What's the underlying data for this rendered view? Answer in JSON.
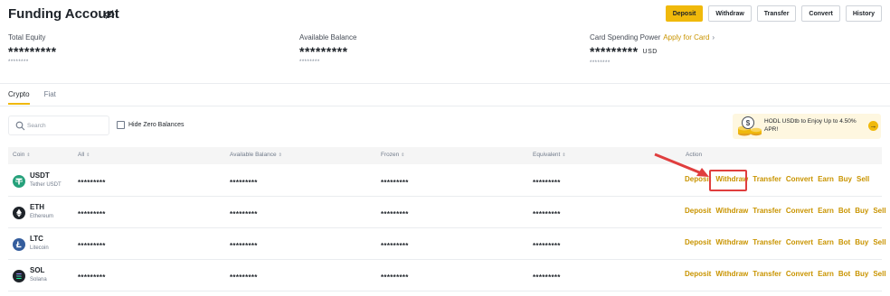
{
  "header": {
    "title": "Funding Account",
    "buttons": [
      "Deposit",
      "Withdraw",
      "Transfer",
      "Convert",
      "History"
    ]
  },
  "summary": {
    "total_equity": {
      "label": "Total Equity",
      "value": "*********",
      "sub": "********"
    },
    "available_balance": {
      "label": "Available Balance",
      "value": "*********",
      "sub": "********"
    },
    "card_power": {
      "label": "Card Spending Power",
      "link": "Apply for Card",
      "value": "*********",
      "unit": "USD",
      "sub": "********"
    }
  },
  "tabs": [
    "Crypto",
    "Fiat"
  ],
  "search": {
    "placeholder": "Search",
    "value": ""
  },
  "hide_zero": {
    "label": "Hide Zero Balances",
    "checked": false
  },
  "promo": {
    "text": "HODL USDtb to Enjoy Up to 4.50% APR!",
    "arrow": "→"
  },
  "table": {
    "headers": {
      "coin": "Coin",
      "all": "All",
      "available": "Available Balance",
      "frozen": "Frozen",
      "equivalent": "Equivalent",
      "action": "Action"
    },
    "rows": [
      {
        "symbol": "USDT",
        "name": "Tether USDT",
        "color": "#26a17b",
        "icon": "tether-icon",
        "all": "*********",
        "available": "*********",
        "frozen": "*********",
        "equivalent": "*********",
        "actions": [
          "Deposit",
          "Withdraw",
          "Transfer",
          "Convert",
          "Earn",
          "Buy",
          "Sell"
        ]
      },
      {
        "symbol": "ETH",
        "name": "Ethereum",
        "color": "#1e2329",
        "icon": "ethereum-icon",
        "all": "*********",
        "available": "*********",
        "frozen": "*********",
        "equivalent": "*********",
        "actions": [
          "Deposit",
          "Withdraw",
          "Transfer",
          "Convert",
          "Earn",
          "Bot",
          "Buy",
          "Sell"
        ]
      },
      {
        "symbol": "LTC",
        "name": "Litecoin",
        "color": "#345d9d",
        "icon": "litecoin-icon",
        "all": "*********",
        "available": "*********",
        "frozen": "*********",
        "equivalent": "*********",
        "actions": [
          "Deposit",
          "Withdraw",
          "Transfer",
          "Convert",
          "Earn",
          "Bot",
          "Buy",
          "Sell"
        ]
      },
      {
        "symbol": "SOL",
        "name": "Solana",
        "color": "#1e2329",
        "icon": "solana-icon",
        "all": "*********",
        "available": "*********",
        "frozen": "*********",
        "equivalent": "*********",
        "actions": [
          "Deposit",
          "Withdraw",
          "Transfer",
          "Convert",
          "Earn",
          "Bot",
          "Buy",
          "Sell"
        ]
      }
    ]
  },
  "colors": {
    "accent": "#f0b90b",
    "action_text": "#c99400",
    "highlight": "#e03e3e"
  }
}
